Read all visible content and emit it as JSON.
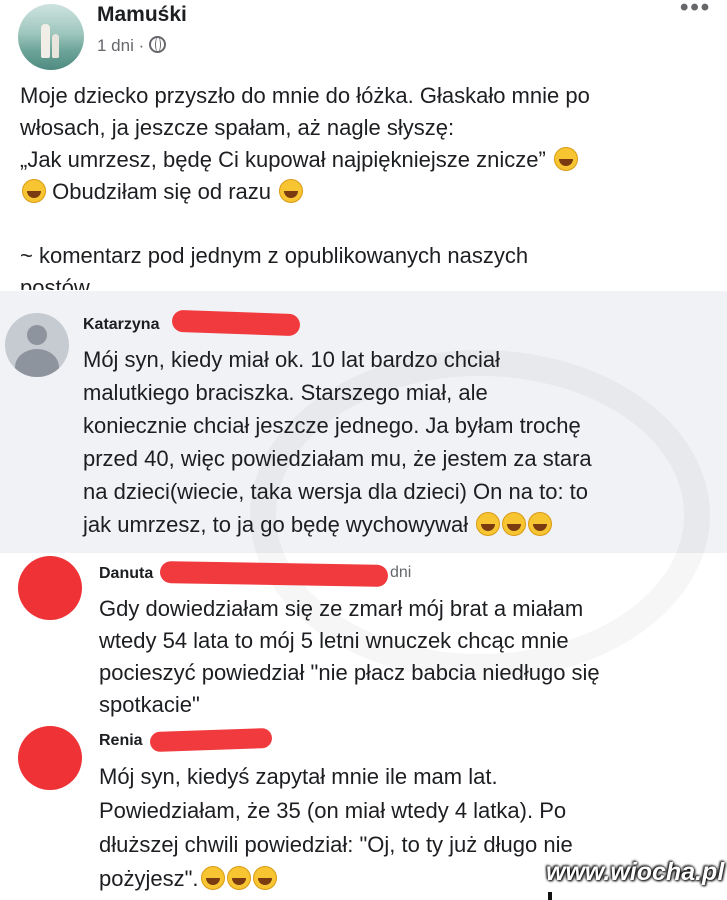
{
  "post": {
    "author": "Mamuśki",
    "time": "1 dni · ",
    "more": "•••",
    "lines": [
      "Moje dziecko przyszło do mnie do łóżka. Głaskało mnie po",
      "włosach, ja jeszcze spałam, aż nagle słyszę:",
      "„Jak umrzesz, będę Ci kupował najpiękniejsze znicze”",
      " Obudziłam się od razu "
    ],
    "note": "~ komentarz pod jednym z opublikowanych naszych",
    "note_cut": "postów"
  },
  "comments": [
    {
      "name": "Katarzyna",
      "lines": [
        "Mój syn, kiedy miał ok. 10 lat bardzo chciał",
        "malutkiego braciszka. Starszego miał, ale",
        "koniecznie chciał jeszcze jednego. Ja byłam trochę",
        "przed 40, więc powiedziałam mu, że jestem za stara",
        "na dzieci(wiecie, taka wersja dla dzieci) On na to: to",
        "jak umrzesz, to ja go będę wychowywał "
      ]
    },
    {
      "name": "Danuta",
      "time": "dni",
      "lines": [
        "Gdy dowiedziałam się ze zmarł mój brat a miałam",
        "wtedy 54 lata to mój 5 letni wnuczek chcąc mnie",
        "pocieszyć powiedział \"nie płacz babcia niedługo się",
        "spotkacie\""
      ]
    },
    {
      "name": "Renia",
      "lines": [
        "Mój syn, kiedyś zapytał mnie ile mam lat.",
        "Powiedziałam, że 35 (on miał wtedy 4 latka). Po",
        "dłuższej chwili powiedział: \"Oj, to ty już długo nie",
        "pożyjesz\"."
      ]
    }
  ],
  "watermark": "www.wiocha.pl",
  "icons": [
    "rolling-laughing-emoji",
    "grinning-emoji",
    "globe-icon",
    "more-icon"
  ]
}
